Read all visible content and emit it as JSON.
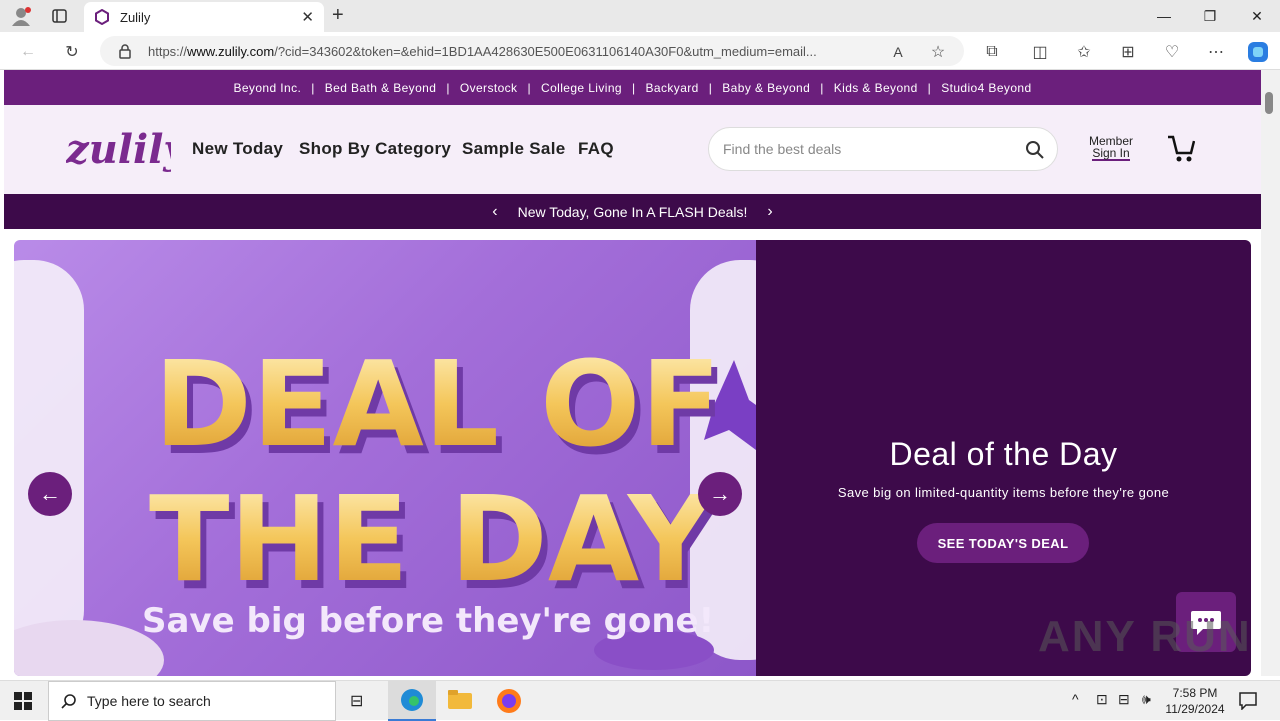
{
  "browser": {
    "tab_title": "Zulily",
    "url_prefix": "https://",
    "url_domain": "www.zulily.com",
    "url_rest": "/?cid=343602&token=&ehid=1BD1AA428630E500E0631106140A30F0&utm_medium=email..."
  },
  "site": {
    "topbar_links": [
      "Beyond Inc.",
      "Bed Bath & Beyond",
      "Overstock",
      "College Living",
      "Backyard",
      "Baby & Beyond",
      "Kids & Beyond",
      "Studio4 Beyond"
    ],
    "nav": [
      "New Today",
      "Shop By Category",
      "Sample Sale",
      "FAQ"
    ],
    "search_placeholder": "Find the best deals",
    "member_line1": "Member",
    "member_line2": "Sign In",
    "promo_text": "New Today, Gone In A FLASH Deals!"
  },
  "hero": {
    "image_line1": "DEAL OF",
    "image_line2": "THE DAY",
    "image_tagline": "Save big before they're gone!",
    "title": "Deal of the Day",
    "subtitle": "Save big on limited-quantity items before they're gone",
    "cta": "SEE TODAY'S DEAL"
  },
  "watermark": "ANY RUN",
  "taskbar": {
    "search_placeholder": "Type here to search",
    "time": "7:58 PM",
    "date": "11/29/2024"
  },
  "colors": {
    "brand": "#6b1f7c",
    "dark": "#3d0a4a",
    "header_bg": "#f6eef9"
  }
}
